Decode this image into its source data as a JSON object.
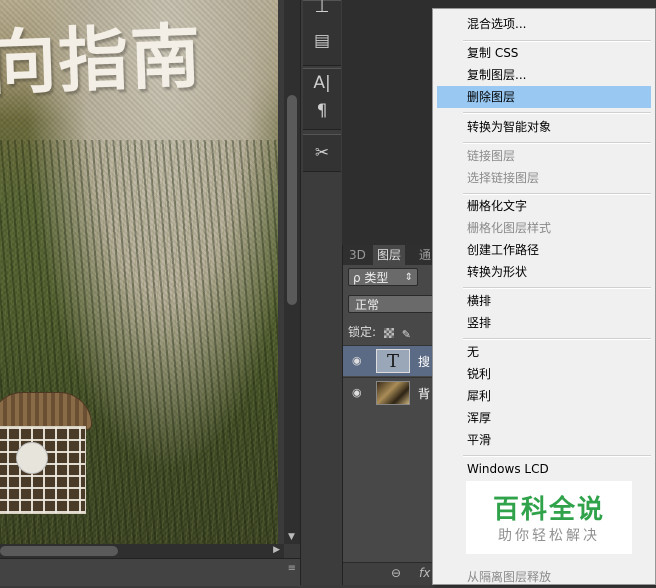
{
  "canvas": {
    "title_text": "向指南"
  },
  "tools": {
    "items": [
      {
        "name": "stamp-tool",
        "glyph": "⊥"
      },
      {
        "name": "paragraph-style-tool",
        "glyph": "▤"
      },
      {
        "name": "character-tool",
        "glyph": "A|"
      },
      {
        "name": "paragraph-tool",
        "glyph": "¶"
      },
      {
        "name": "tool-presets",
        "glyph": "✂"
      }
    ]
  },
  "layers_panel": {
    "tabs": [
      "3D",
      "图层",
      "通"
    ],
    "active_tab": "图层",
    "filter_label": "ρ 类型",
    "filter_arrow": "⇕",
    "blend_mode": "正常",
    "lock_label": "锁定:",
    "layers": [
      {
        "name": "搜",
        "type": "text",
        "thumb": "T",
        "selected": true
      },
      {
        "name": "背",
        "type": "image",
        "selected": false
      }
    ],
    "footer_icons": [
      "⊖",
      "fx"
    ]
  },
  "context_menu": {
    "items": [
      {
        "label": "混合选项...",
        "disabled": false
      },
      {
        "separator": true
      },
      {
        "label": "复制 CSS",
        "disabled": false
      },
      {
        "label": "复制图层...",
        "disabled": false
      },
      {
        "label": "删除图层",
        "disabled": false,
        "highlighted": true
      },
      {
        "separator": true
      },
      {
        "label": "转换为智能对象",
        "disabled": false
      },
      {
        "separator": true
      },
      {
        "label": "链接图层",
        "disabled": true
      },
      {
        "label": "选择链接图层",
        "disabled": true
      },
      {
        "separator": true
      },
      {
        "label": "栅格化文字",
        "disabled": false
      },
      {
        "label": "栅格化图层样式",
        "disabled": true
      },
      {
        "label": "创建工作路径",
        "disabled": false
      },
      {
        "label": "转换为形状",
        "disabled": false
      },
      {
        "separator": true
      },
      {
        "label": "横排",
        "disabled": false
      },
      {
        "label": "竖排",
        "disabled": false
      },
      {
        "separator": true
      },
      {
        "label": "无",
        "disabled": false
      },
      {
        "label": "锐利",
        "disabled": false
      },
      {
        "label": "犀利",
        "disabled": false
      },
      {
        "label": "浑厚",
        "disabled": false
      },
      {
        "label": "平滑",
        "disabled": false
      },
      {
        "separator": true
      },
      {
        "label": "Windows LCD",
        "disabled": false
      },
      {
        "label": "从隔离图层释放",
        "disabled": true
      }
    ]
  },
  "watermark": {
    "title": "百科全说",
    "subtitle": "助你轻松解决"
  },
  "colors": {
    "menu_highlight": "#99c9f3",
    "selected_layer": "#5b6b85",
    "watermark_green": "#2fa24a"
  }
}
